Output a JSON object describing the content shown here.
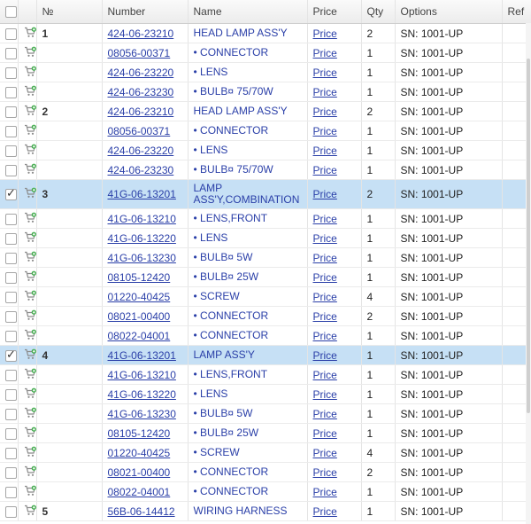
{
  "header": {
    "number_symbol": "№",
    "number": "Number",
    "name": "Name",
    "price": "Price",
    "qty": "Qty",
    "options": "Options",
    "ref": "Ref"
  },
  "rows": [
    {
      "pos": "1",
      "number": "424-06-23210",
      "name": "HEAD LAMP ASS'Y",
      "price": "Price",
      "qty": "2",
      "options": "SN: 1001-UP",
      "checked": false
    },
    {
      "pos": "",
      "number": "08056-00371",
      "name": "• CONNECTOR",
      "price": "Price",
      "qty": "1",
      "options": "SN: 1001-UP",
      "checked": false
    },
    {
      "pos": "",
      "number": "424-06-23220",
      "name": "• LENS",
      "price": "Price",
      "qty": "1",
      "options": "SN: 1001-UP",
      "checked": false
    },
    {
      "pos": "",
      "number": "424-06-23230",
      "name": "• BULB¤ 75/70W",
      "price": "Price",
      "qty": "1",
      "options": "SN: 1001-UP",
      "checked": false
    },
    {
      "pos": "2",
      "number": "424-06-23210",
      "name": "HEAD LAMP ASS'Y",
      "price": "Price",
      "qty": "2",
      "options": "SN: 1001-UP",
      "checked": false
    },
    {
      "pos": "",
      "number": "08056-00371",
      "name": "• CONNECTOR",
      "price": "Price",
      "qty": "1",
      "options": "SN: 1001-UP",
      "checked": false
    },
    {
      "pos": "",
      "number": "424-06-23220",
      "name": "• LENS",
      "price": "Price",
      "qty": "1",
      "options": "SN: 1001-UP",
      "checked": false
    },
    {
      "pos": "",
      "number": "424-06-23230",
      "name": "• BULB¤ 75/70W",
      "price": "Price",
      "qty": "1",
      "options": "SN: 1001-UP",
      "checked": false
    },
    {
      "pos": "3",
      "number": "41G-06-13201",
      "name": "LAMP ASS'Y,COMBINATION",
      "price": "Price",
      "qty": "2",
      "options": "SN: 1001-UP",
      "checked": true,
      "tall": true
    },
    {
      "pos": "",
      "number": "41G-06-13210",
      "name": "• LENS,FRONT",
      "price": "Price",
      "qty": "1",
      "options": "SN: 1001-UP",
      "checked": false
    },
    {
      "pos": "",
      "number": "41G-06-13220",
      "name": "• LENS",
      "price": "Price",
      "qty": "1",
      "options": "SN: 1001-UP",
      "checked": false
    },
    {
      "pos": "",
      "number": "41G-06-13230",
      "name": "• BULB¤ 5W",
      "price": "Price",
      "qty": "1",
      "options": "SN: 1001-UP",
      "checked": false
    },
    {
      "pos": "",
      "number": "08105-12420",
      "name": "• BULB¤ 25W",
      "price": "Price",
      "qty": "1",
      "options": "SN: 1001-UP",
      "checked": false
    },
    {
      "pos": "",
      "number": "01220-40425",
      "name": "• SCREW",
      "price": "Price",
      "qty": "4",
      "options": "SN: 1001-UP",
      "checked": false
    },
    {
      "pos": "",
      "number": "08021-00400",
      "name": "• CONNECTOR",
      "price": "Price",
      "qty": "2",
      "options": "SN: 1001-UP",
      "checked": false
    },
    {
      "pos": "",
      "number": "08022-04001",
      "name": "• CONNECTOR",
      "price": "Price",
      "qty": "1",
      "options": "SN: 1001-UP",
      "checked": false
    },
    {
      "pos": "4",
      "number": "41G-06-13201",
      "name": "LAMP ASS'Y",
      "price": "Price",
      "qty": "1",
      "options": "SN: 1001-UP",
      "checked": true
    },
    {
      "pos": "",
      "number": "41G-06-13210",
      "name": "• LENS,FRONT",
      "price": "Price",
      "qty": "1",
      "options": "SN: 1001-UP",
      "checked": false
    },
    {
      "pos": "",
      "number": "41G-06-13220",
      "name": "• LENS",
      "price": "Price",
      "qty": "1",
      "options": "SN: 1001-UP",
      "checked": false
    },
    {
      "pos": "",
      "number": "41G-06-13230",
      "name": "• BULB¤ 5W",
      "price": "Price",
      "qty": "1",
      "options": "SN: 1001-UP",
      "checked": false
    },
    {
      "pos": "",
      "number": "08105-12420",
      "name": "• BULB¤ 25W",
      "price": "Price",
      "qty": "1",
      "options": "SN: 1001-UP",
      "checked": false
    },
    {
      "pos": "",
      "number": "01220-40425",
      "name": "• SCREW",
      "price": "Price",
      "qty": "4",
      "options": "SN: 1001-UP",
      "checked": false
    },
    {
      "pos": "",
      "number": "08021-00400",
      "name": "• CONNECTOR",
      "price": "Price",
      "qty": "2",
      "options": "SN: 1001-UP",
      "checked": false
    },
    {
      "pos": "",
      "number": "08022-04001",
      "name": "• CONNECTOR",
      "price": "Price",
      "qty": "1",
      "options": "SN: 1001-UP",
      "checked": false
    },
    {
      "pos": "5",
      "number": "56B-06-14412",
      "name": "WIRING HARNESS",
      "price": "Price",
      "qty": "1",
      "options": "SN: 1001-UP",
      "checked": false
    }
  ],
  "icons": {
    "row_checkbox": "checkbox",
    "cart": "add-to-cart-icon"
  },
  "colors": {
    "link": "#2a3fa8",
    "selected_row": "#c6e0f5",
    "cart_green": "#3aa845"
  }
}
